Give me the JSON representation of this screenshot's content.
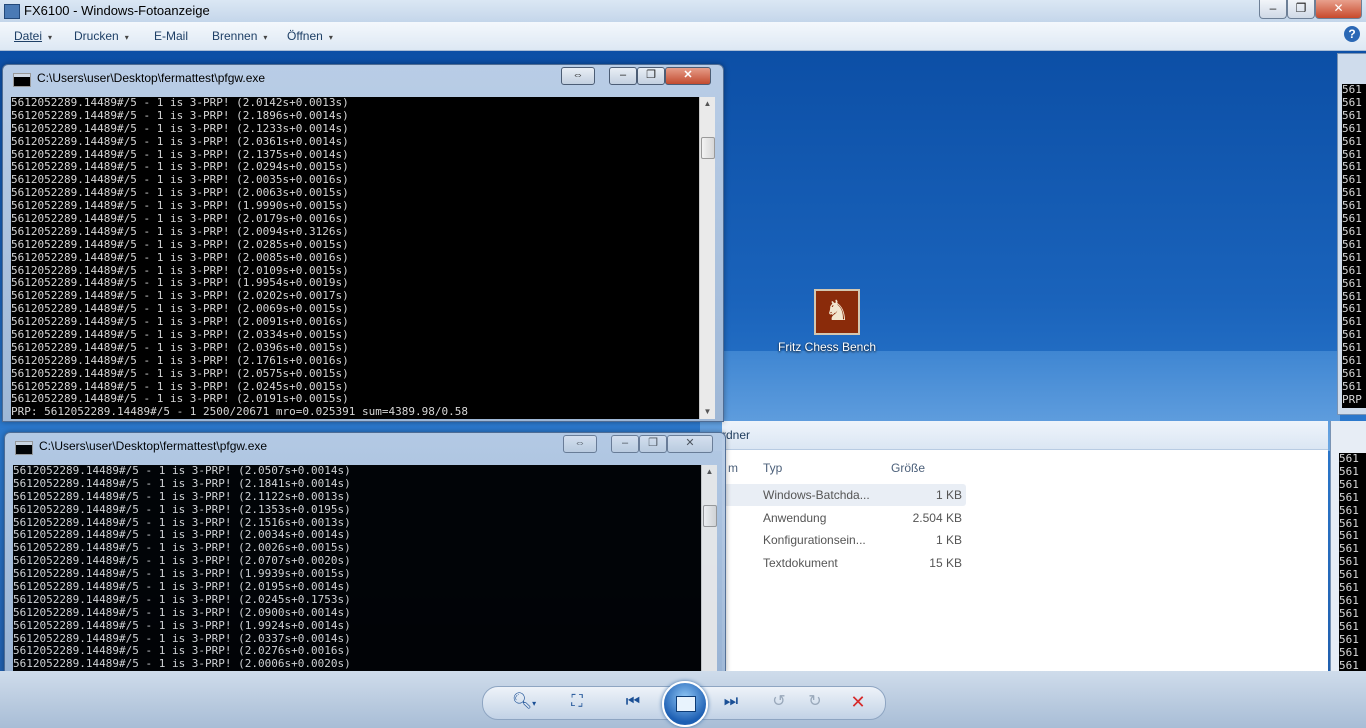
{
  "viewer": {
    "title": "FX6100 - Windows-Fotoanzeige",
    "controls": [
      "–",
      "❐",
      "✕"
    ]
  },
  "menu": {
    "items": [
      {
        "label": "Datei",
        "arrow": "▾"
      },
      {
        "label": "Drucken",
        "arrow": "▾"
      },
      {
        "label": "E-Mail",
        "arrow": ""
      },
      {
        "label": "Brennen",
        "arrow": "▾"
      },
      {
        "label": "Öffnen",
        "arrow": "▾"
      }
    ],
    "help": "?"
  },
  "desktop": {
    "fritz_label": "Fritz Chess Bench",
    "fritz_icon": "knight-icon"
  },
  "console1": {
    "title": "C:\\Users\\user\\Desktop\\fermattest\\pfgw.exe",
    "lines": [
      "5612052289.14489#/5 - 1 is 3-PRP! (2.0142s+0.0013s)",
      "5612052289.14489#/5 - 1 is 3-PRP! (2.1896s+0.0014s)",
      "5612052289.14489#/5 - 1 is 3-PRP! (2.1233s+0.0014s)",
      "5612052289.14489#/5 - 1 is 3-PRP! (2.0361s+0.0014s)",
      "5612052289.14489#/5 - 1 is 3-PRP! (2.1375s+0.0014s)",
      "5612052289.14489#/5 - 1 is 3-PRP! (2.0294s+0.0015s)",
      "5612052289.14489#/5 - 1 is 3-PRP! (2.0035s+0.0016s)",
      "5612052289.14489#/5 - 1 is 3-PRP! (2.0063s+0.0015s)",
      "5612052289.14489#/5 - 1 is 3-PRP! (1.9990s+0.0015s)",
      "5612052289.14489#/5 - 1 is 3-PRP! (2.0179s+0.0016s)",
      "5612052289.14489#/5 - 1 is 3-PRP! (2.0094s+0.3126s)",
      "5612052289.14489#/5 - 1 is 3-PRP! (2.0285s+0.0015s)",
      "5612052289.14489#/5 - 1 is 3-PRP! (2.0085s+0.0016s)",
      "5612052289.14489#/5 - 1 is 3-PRP! (2.0109s+0.0015s)",
      "5612052289.14489#/5 - 1 is 3-PRP! (1.9954s+0.0019s)",
      "5612052289.14489#/5 - 1 is 3-PRP! (2.0202s+0.0017s)",
      "5612052289.14489#/5 - 1 is 3-PRP! (2.0069s+0.0015s)",
      "5612052289.14489#/5 - 1 is 3-PRP! (2.0091s+0.0016s)",
      "5612052289.14489#/5 - 1 is 3-PRP! (2.0334s+0.0015s)",
      "5612052289.14489#/5 - 1 is 3-PRP! (2.0396s+0.0015s)",
      "5612052289.14489#/5 - 1 is 3-PRP! (2.1761s+0.0016s)",
      "5612052289.14489#/5 - 1 is 3-PRP! (2.0575s+0.0015s)",
      "5612052289.14489#/5 - 1 is 3-PRP! (2.0245s+0.0015s)",
      "5612052289.14489#/5 - 1 is 3-PRP! (2.0191s+0.0015s)",
      "PRP: 5612052289.14489#/5 - 1 2500/20671 mro=0.025391 sum=4389.98/0.58"
    ]
  },
  "console2": {
    "title": "C:\\Users\\user\\Desktop\\fermattest\\pfgw.exe",
    "lines": [
      "5612052289.14489#/5 - 1 is 3-PRP! (2.0507s+0.0014s)",
      "5612052289.14489#/5 - 1 is 3-PRP! (2.1841s+0.0014s)",
      "5612052289.14489#/5 - 1 is 3-PRP! (2.1122s+0.0013s)",
      "5612052289.14489#/5 - 1 is 3-PRP! (2.1353s+0.0195s)",
      "5612052289.14489#/5 - 1 is 3-PRP! (2.1516s+0.0013s)",
      "5612052289.14489#/5 - 1 is 3-PRP! (2.0034s+0.0014s)",
      "5612052289.14489#/5 - 1 is 3-PRP! (2.0026s+0.0015s)",
      "5612052289.14489#/5 - 1 is 3-PRP! (2.0707s+0.0020s)",
      "5612052289.14489#/5 - 1 is 3-PRP! (1.9939s+0.0015s)",
      "5612052289.14489#/5 - 1 is 3-PRP! (2.0195s+0.0014s)",
      "5612052289.14489#/5 - 1 is 3-PRP! (2.0245s+0.1753s)",
      "5612052289.14489#/5 - 1 is 3-PRP! (2.0900s+0.0014s)",
      "5612052289.14489#/5 - 1 is 3-PRP! (1.9924s+0.0014s)",
      "5612052289.14489#/5 - 1 is 3-PRP! (2.0337s+0.0014s)",
      "5612052289.14489#/5 - 1 is 3-PRP! (2.0276s+0.0016s)",
      "5612052289.14489#/5 - 1 is 3-PRP! (2.0006s+0.0020s)"
    ]
  },
  "explorer": {
    "partial_header": "rdner",
    "col_name_fragment": "m",
    "col_type": "Typ",
    "col_size": "Größe",
    "rows": [
      {
        "type": "Windows-Batchda...",
        "size": "1 KB"
      },
      {
        "type": "Anwendung",
        "size": "2.504 KB"
      },
      {
        "type": "Konfigurationsein...",
        "size": "1 KB"
      },
      {
        "type": "Textdokument",
        "size": "15 KB"
      }
    ]
  },
  "right_console": {
    "lines": [
      "561",
      "561",
      "561",
      "561",
      "561",
      "561",
      "561",
      "561",
      "561",
      "561",
      "561",
      "561",
      "561",
      "561",
      "561",
      "561",
      "561",
      "561",
      "561",
      "561",
      "561",
      "561",
      "561",
      "561",
      "PRP"
    ]
  },
  "right_console2": {
    "lines": [
      "561",
      "561",
      "561",
      "561",
      "561",
      "561",
      "561",
      "561",
      "561",
      "561",
      "561",
      "561",
      "561",
      "561",
      "561",
      "561",
      "561"
    ]
  },
  "toolbar": {
    "zoom": "zoom-icon",
    "fit": "fit-to-window-icon",
    "prev": "previous-icon",
    "slideshow": "slideshow-icon",
    "next": "next-icon",
    "rotate_left": "rotate-left-icon",
    "rotate_right": "rotate-right-icon",
    "delete": "delete-icon"
  }
}
